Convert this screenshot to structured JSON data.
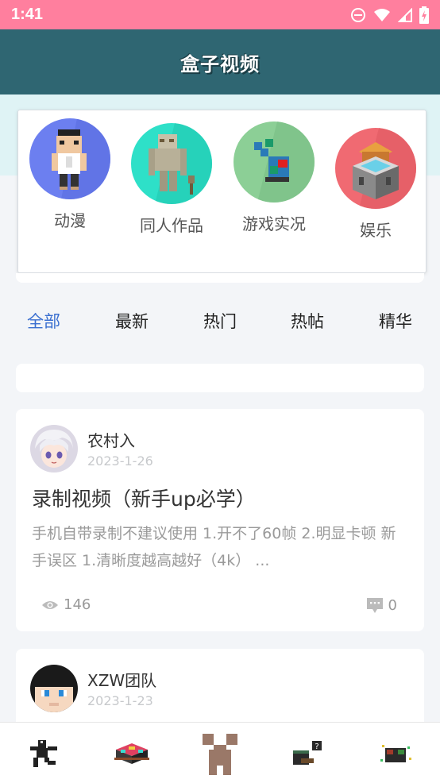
{
  "status_bar": {
    "time": "1:41"
  },
  "app": {
    "title": "盒子视频"
  },
  "categories": [
    {
      "label": "动漫",
      "icon": "anime-icon",
      "color": "#6c7ff0"
    },
    {
      "label": "同人作品",
      "icon": "fan-works-icon",
      "color": "#2ee0c8"
    },
    {
      "label": "游戏实况",
      "icon": "gameplay-icon",
      "color": "#8ccf96"
    },
    {
      "label": "娱乐",
      "icon": "entertainment-icon",
      "color": "#f06a72"
    }
  ],
  "tabs": [
    {
      "label": "全部",
      "active": true
    },
    {
      "label": "最新",
      "active": false
    },
    {
      "label": "热门",
      "active": false
    },
    {
      "label": "热帖",
      "active": false
    },
    {
      "label": "精华",
      "active": false
    }
  ],
  "posts": [
    {
      "author": "农村入",
      "date": "2023-1-26",
      "title": "录制视频（新手up必学）",
      "excerpt": "手机自带录制不建议使用 1.开不了60帧 2.明显卡顿 新手误区 1.清晰度越高越好（4k） ...",
      "views": "146",
      "comments": "0"
    },
    {
      "author": "XZW团队",
      "date": "2023-1-23"
    }
  ],
  "bottom_nav": [
    {
      "icon": "runner-icon"
    },
    {
      "icon": "treasure-chest-icon"
    },
    {
      "icon": "creeper-face-icon"
    },
    {
      "icon": "question-block-icon"
    },
    {
      "icon": "sparkle-character-icon"
    }
  ]
}
